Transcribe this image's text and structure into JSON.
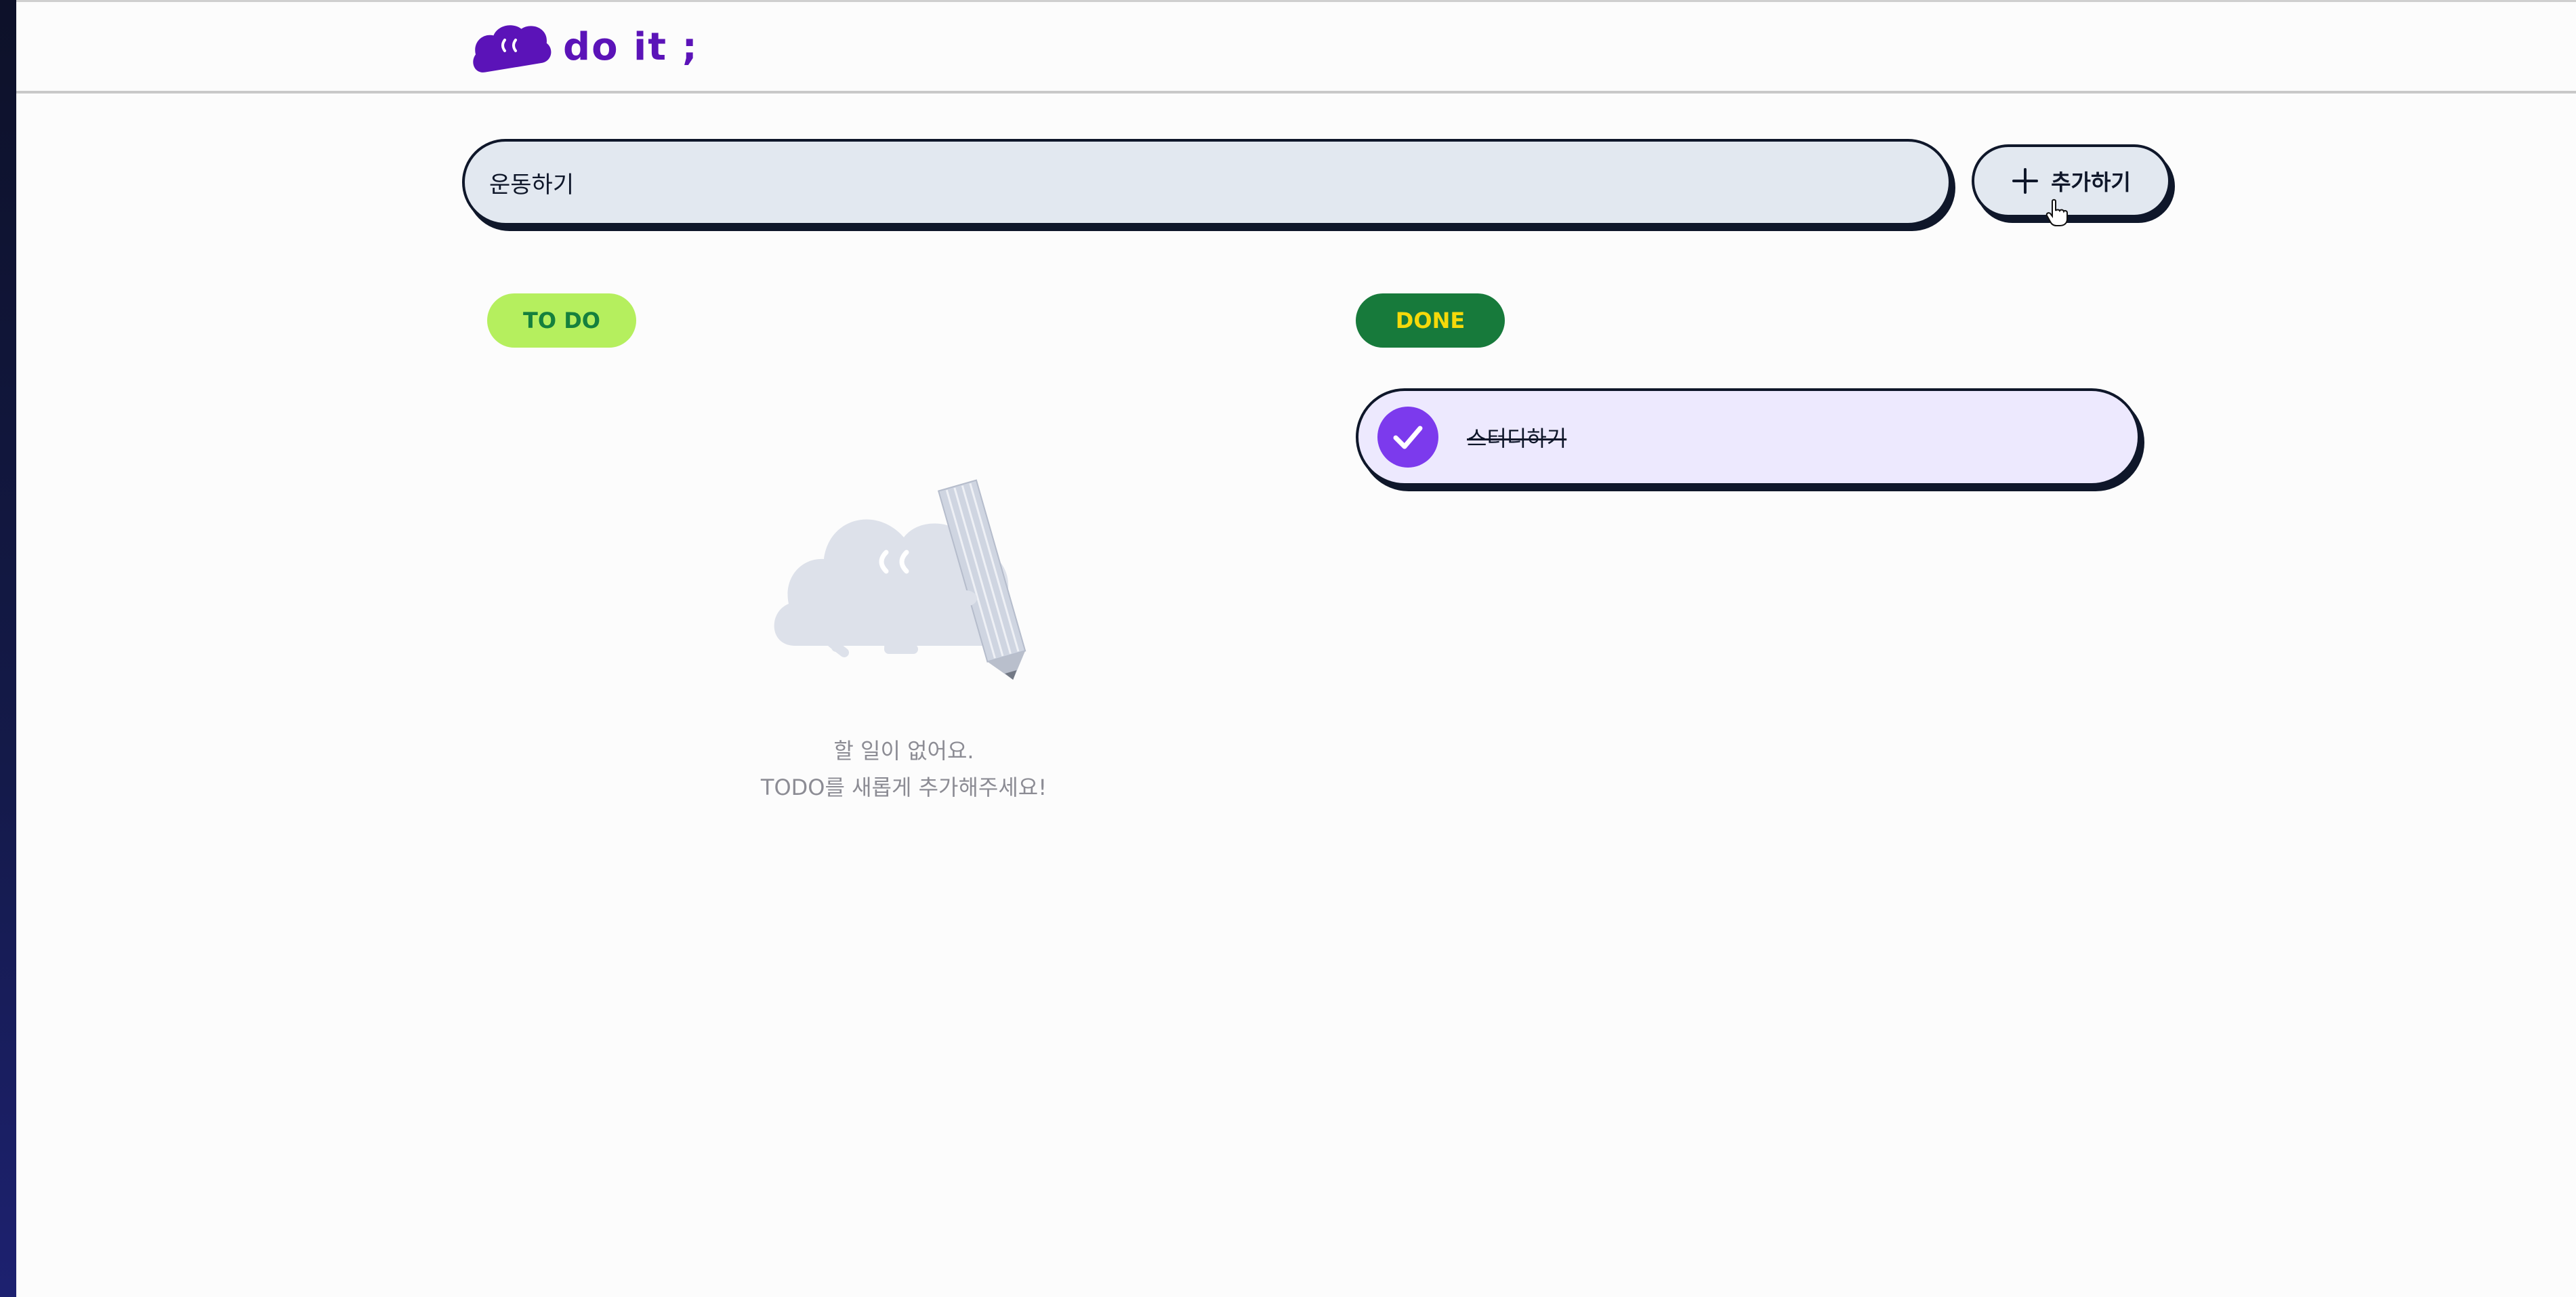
{
  "header": {
    "logo_text": "do it ;"
  },
  "add_form": {
    "input_value": "운동하기",
    "button_label": "추가하기"
  },
  "todo_section": {
    "badge_label": "TO DO",
    "empty_line_1": "할 일이 없어요.",
    "empty_line_2": "TODO를 새롭게 추가해주세요!"
  },
  "done_section": {
    "badge_label": "DONE",
    "items": [
      {
        "label": "스터디하기",
        "completed": true
      }
    ]
  },
  "colors": {
    "brand_purple": "#5b13b8",
    "check_purple": "#7c3aed",
    "todo_badge_bg": "#b5ef5e",
    "done_badge_bg": "#177a3b",
    "input_bg": "#e2e8f0",
    "done_item_bg": "#ede9fe"
  },
  "icons": {
    "logo": "logo-cloud-icon",
    "add": "plus-icon",
    "check": "check-icon",
    "empty": "empty-todo-illustration",
    "cursor": "hand-pointer-icon"
  }
}
